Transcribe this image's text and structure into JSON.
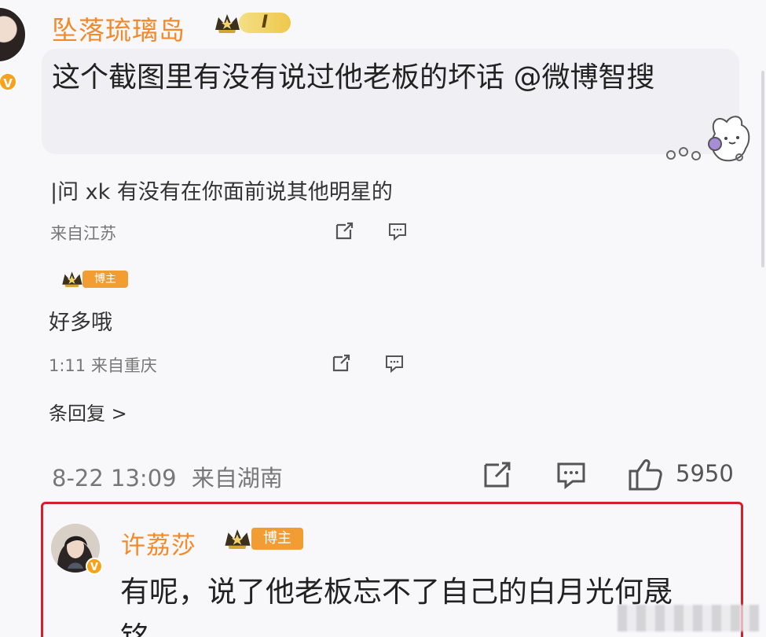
{
  "top_comment": {
    "username": "坠落琉璃岛",
    "level_label": "I",
    "text": "这个截图里有没有说过他老板的坏话 @微博智搜"
  },
  "faint_replies": [
    {
      "text": "|问 xk 有没有在你面前说其他明星的",
      "meta": "来自江苏"
    },
    {
      "role_badge": "博主",
      "text": "好多哦",
      "meta": "1:11 来自重庆"
    }
  ],
  "reply_link": "条回复 >",
  "main_meta": {
    "datetime": "8-22 13:09",
    "location": "来自湖南",
    "like_count": "5950"
  },
  "highlighted_reply": {
    "username": "许荔莎",
    "role_badge": "博主",
    "text": "有呢，说了他老板忘不了自己的白月光何晟",
    "cut_text": "铭"
  },
  "colors": {
    "username": "#f28a2b",
    "verified": "#f7a21b",
    "highlight_border": "#d51f2c",
    "role_badge": "#f29c34"
  }
}
